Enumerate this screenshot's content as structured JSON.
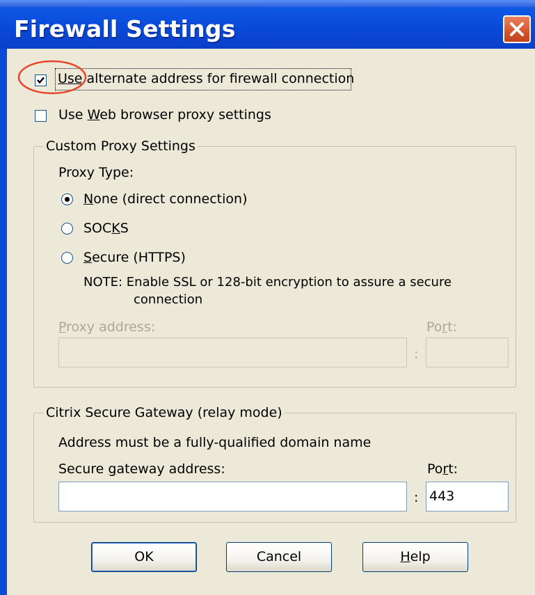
{
  "window": {
    "title": "Firewall Settings",
    "close_icon": "close-icon"
  },
  "options": {
    "alt_address": {
      "label_prefix": "Use",
      "label_rest": " alternate address for firewall connection",
      "checked": true
    },
    "web_proxy": {
      "label_pre": "Use ",
      "label_accel": "W",
      "label_rest": "eb browser proxy settings",
      "checked": false
    }
  },
  "custom_proxy": {
    "legend": "Custom Proxy Settings",
    "proxy_type_label": "Proxy Type:",
    "radios": [
      {
        "accel": "N",
        "rest": "one (direct connection)",
        "selected": true
      },
      {
        "pre": "SOC",
        "accel": "K",
        "rest": "S",
        "selected": false
      },
      {
        "accel": "S",
        "rest": "ecure (HTTPS)",
        "selected": false
      }
    ],
    "note_line1": "NOTE: Enable SSL or 128-bit encryption to  assure a secure",
    "note_line2": "connection",
    "proxy_address_accel": "P",
    "proxy_address_rest": "roxy address:",
    "port_pre": "Po",
    "port_accel": "r",
    "port_rest": "t:",
    "colon": ":",
    "proxy_address_value": "",
    "port_value": ""
  },
  "gateway": {
    "legend": "Citrix Secure Gateway (relay mode)",
    "hint": "Address must be a fully-qualified domain name",
    "address_pre": "Secure ",
    "address_accel": "g",
    "address_rest": "ateway address:",
    "port_pre": "Po",
    "port_accel": "r",
    "port_rest": "t:",
    "colon": ":",
    "address_value": "",
    "port_value": "443"
  },
  "buttons": {
    "ok": "OK",
    "cancel": "Cancel",
    "help_accel": "H",
    "help_rest": "elp"
  },
  "colors": {
    "titlebar": "#0a4ad8",
    "annotation": "#e8462c",
    "dialog_bg": "#ece9d8"
  }
}
